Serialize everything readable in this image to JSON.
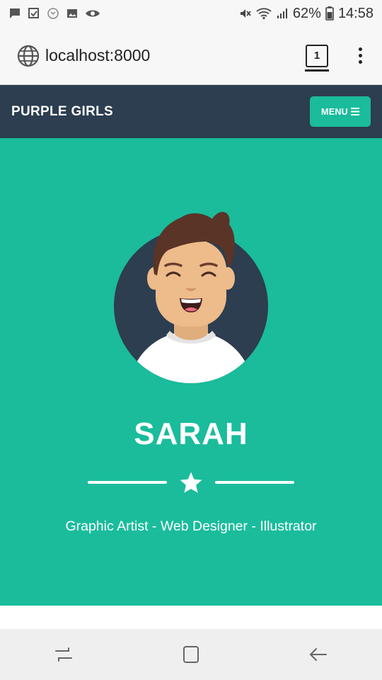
{
  "status_bar": {
    "battery": "62%",
    "time": "14:58",
    "icons_left": [
      "message-icon",
      "checkbox-icon",
      "missed-call-icon",
      "image-icon",
      "eye-icon"
    ],
    "icons_right": [
      "mute-icon",
      "wifi-icon",
      "signal-icon",
      "battery-icon"
    ]
  },
  "browser": {
    "url": "localhost:8000",
    "tab_count": "1"
  },
  "navbar": {
    "brand": "PURPLE GIRLS",
    "menu_label": "MENU"
  },
  "hero": {
    "name": "SARAH",
    "subtitle": "Graphic Artist - Web Designer - Illustrator"
  },
  "colors": {
    "navbar_bg": "#2c3e50",
    "accent": "#1abc9c",
    "text_on_accent": "#ffffff"
  },
  "android_nav": {
    "icons": [
      "recents-icon",
      "home-icon",
      "back-icon"
    ]
  }
}
